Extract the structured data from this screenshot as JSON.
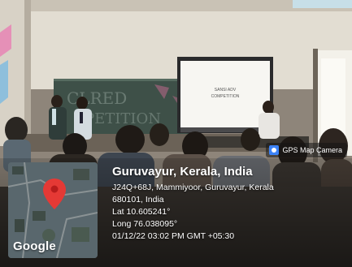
{
  "badge": {
    "label": "GPS Map Camera",
    "icon": "camera-icon"
  },
  "map": {
    "attribution": "Google",
    "marker_color": "#e53935"
  },
  "location": {
    "title": "Guruvayur, Kerala, India",
    "address_line1": "J24Q+68J, Mammiyoor, Guruvayur, Kerala",
    "address_line2": "680101, India",
    "lat": "Lat 10.605241°",
    "long": "Long 76.038095°",
    "datetime": "01/12/22 03:02 PM GMT +05:30"
  },
  "scene": {
    "chalkboard_text_1": "CLRED",
    "chalkboard_text_2": "PETITION",
    "projector_text_1": "SANSI ADV",
    "projector_text_2": "COMPETITION"
  }
}
